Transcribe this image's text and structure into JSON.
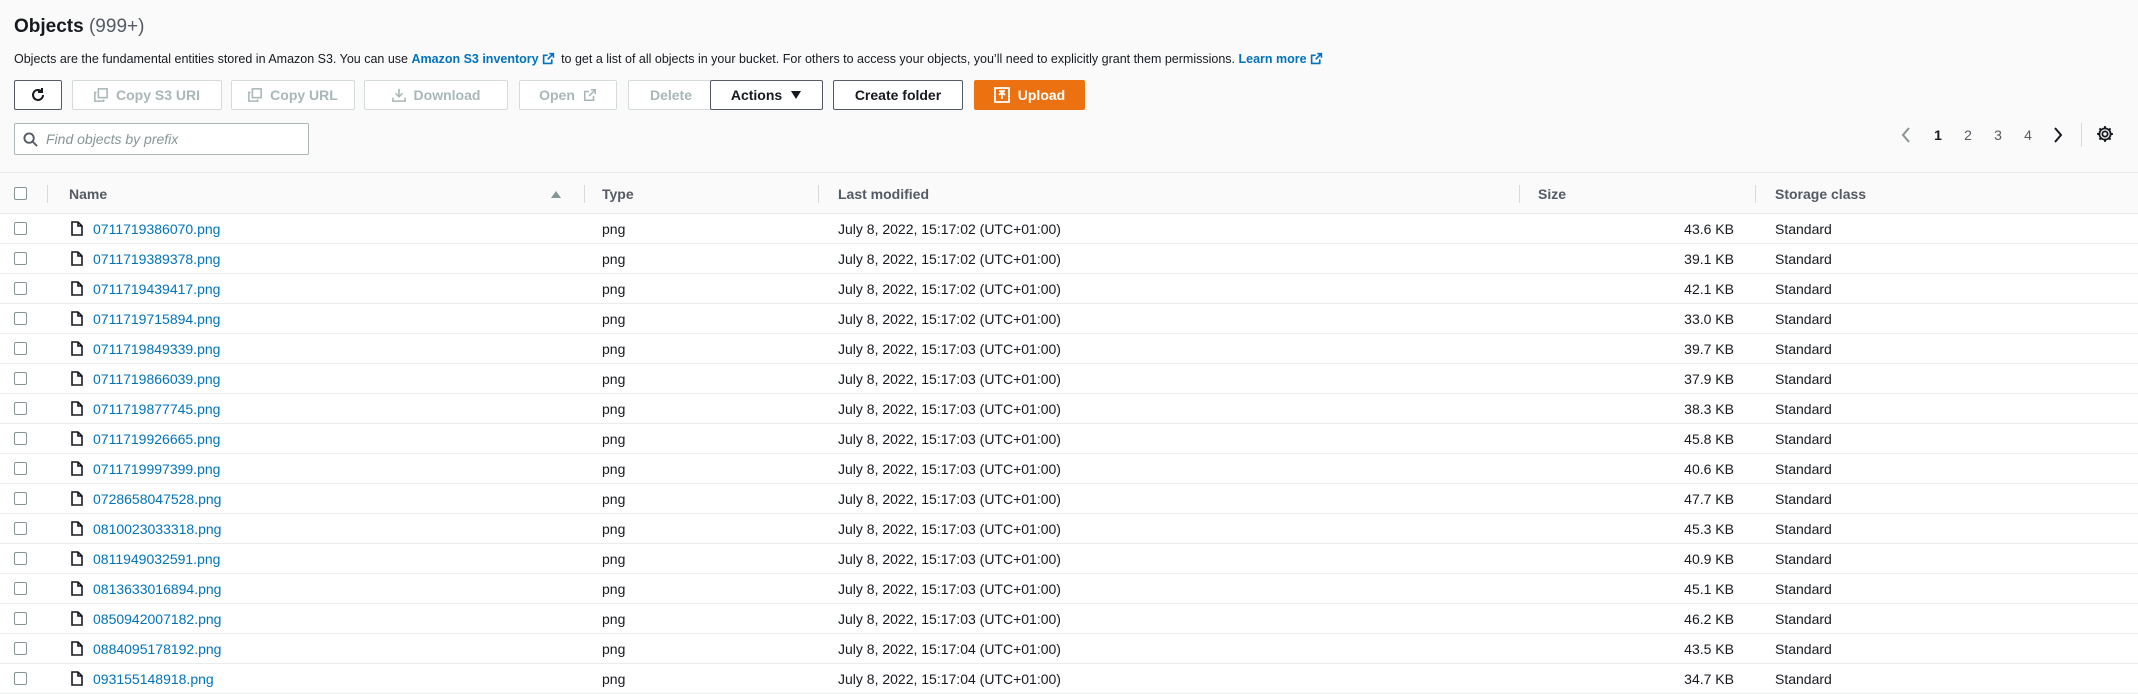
{
  "header": {
    "title": "Objects",
    "count": "(999+)"
  },
  "description": {
    "text_before": "Objects are the fundamental entities stored in Amazon S3. You can use ",
    "inventory_link": "Amazon S3 inventory",
    "text_middle": " to get a list of all objects in your bucket. For others to access your objects, you’ll need to explicitly grant them permissions. ",
    "learn_more": "Learn more"
  },
  "toolbar": {
    "copy_s3_uri": "Copy S3 URI",
    "copy_url": "Copy URL",
    "download": "Download",
    "open": "Open",
    "delete": "Delete",
    "actions": "Actions",
    "create_folder": "Create folder",
    "upload": "Upload"
  },
  "search": {
    "placeholder": "Find objects by prefix"
  },
  "pagination": {
    "pages": [
      "1",
      "2",
      "3",
      "4"
    ],
    "current": "1"
  },
  "table": {
    "columns": {
      "name": "Name",
      "type": "Type",
      "last_modified": "Last modified",
      "size": "Size",
      "storage_class": "Storage class"
    },
    "rows": [
      {
        "name": "0711719386070.png",
        "type": "png",
        "modified": "July 8, 2022, 15:17:02 (UTC+01:00)",
        "size": "43.6 KB",
        "storage": "Standard"
      },
      {
        "name": "0711719389378.png",
        "type": "png",
        "modified": "July 8, 2022, 15:17:02 (UTC+01:00)",
        "size": "39.1 KB",
        "storage": "Standard"
      },
      {
        "name": "0711719439417.png",
        "type": "png",
        "modified": "July 8, 2022, 15:17:02 (UTC+01:00)",
        "size": "42.1 KB",
        "storage": "Standard"
      },
      {
        "name": "0711719715894.png",
        "type": "png",
        "modified": "July 8, 2022, 15:17:02 (UTC+01:00)",
        "size": "33.0 KB",
        "storage": "Standard"
      },
      {
        "name": "0711719849339.png",
        "type": "png",
        "modified": "July 8, 2022, 15:17:03 (UTC+01:00)",
        "size": "39.7 KB",
        "storage": "Standard"
      },
      {
        "name": "0711719866039.png",
        "type": "png",
        "modified": "July 8, 2022, 15:17:03 (UTC+01:00)",
        "size": "37.9 KB",
        "storage": "Standard"
      },
      {
        "name": "0711719877745.png",
        "type": "png",
        "modified": "July 8, 2022, 15:17:03 (UTC+01:00)",
        "size": "38.3 KB",
        "storage": "Standard"
      },
      {
        "name": "0711719926665.png",
        "type": "png",
        "modified": "July 8, 2022, 15:17:03 (UTC+01:00)",
        "size": "45.8 KB",
        "storage": "Standard"
      },
      {
        "name": "0711719997399.png",
        "type": "png",
        "modified": "July 8, 2022, 15:17:03 (UTC+01:00)",
        "size": "40.6 KB",
        "storage": "Standard"
      },
      {
        "name": "0728658047528.png",
        "type": "png",
        "modified": "July 8, 2022, 15:17:03 (UTC+01:00)",
        "size": "47.7 KB",
        "storage": "Standard"
      },
      {
        "name": "0810023033318.png",
        "type": "png",
        "modified": "July 8, 2022, 15:17:03 (UTC+01:00)",
        "size": "45.3 KB",
        "storage": "Standard"
      },
      {
        "name": "0811949032591.png",
        "type": "png",
        "modified": "July 8, 2022, 15:17:03 (UTC+01:00)",
        "size": "40.9 KB",
        "storage": "Standard"
      },
      {
        "name": "0813633016894.png",
        "type": "png",
        "modified": "July 8, 2022, 15:17:03 (UTC+01:00)",
        "size": "45.1 KB",
        "storage": "Standard"
      },
      {
        "name": "0850942007182.png",
        "type": "png",
        "modified": "July 8, 2022, 15:17:03 (UTC+01:00)",
        "size": "46.2 KB",
        "storage": "Standard"
      },
      {
        "name": "0884095178192.png",
        "type": "png",
        "modified": "July 8, 2022, 15:17:04 (UTC+01:00)",
        "size": "43.5 KB",
        "storage": "Standard"
      },
      {
        "name": "093155148918.png",
        "type": "png",
        "modified": "July 8, 2022, 15:17:04 (UTC+01:00)",
        "size": "34.7 KB",
        "storage": "Standard"
      }
    ]
  },
  "colors": {
    "link": "#0073bb",
    "primary": "#ec7211",
    "text": "#16191f",
    "muted": "#545b64",
    "disabled": "#aab7b8"
  }
}
